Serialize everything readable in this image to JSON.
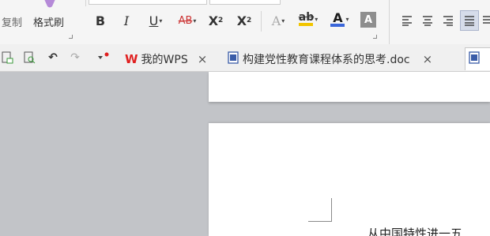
{
  "ribbon": {
    "copy_label": "复制",
    "format_painter_label": "格式刷",
    "bold": "B",
    "italic": "I",
    "underline": "U",
    "strikethrough": "AB",
    "superscript_base": "X",
    "superscript_exp": "2",
    "subscript_base": "X",
    "subscript_sub": "2",
    "text_effect": "A",
    "highlight": "ab",
    "font_color": "A",
    "char_shading": "A",
    "highlight_color": "#f2c500",
    "font_color_value": "#e02020"
  },
  "tabs": [
    {
      "label": "我的WPS",
      "close": "×"
    },
    {
      "label": "构建党性教育课程体系的思考.doc",
      "close": "×"
    }
  ],
  "document": {
    "visible_text": "从中国特性进一五"
  }
}
